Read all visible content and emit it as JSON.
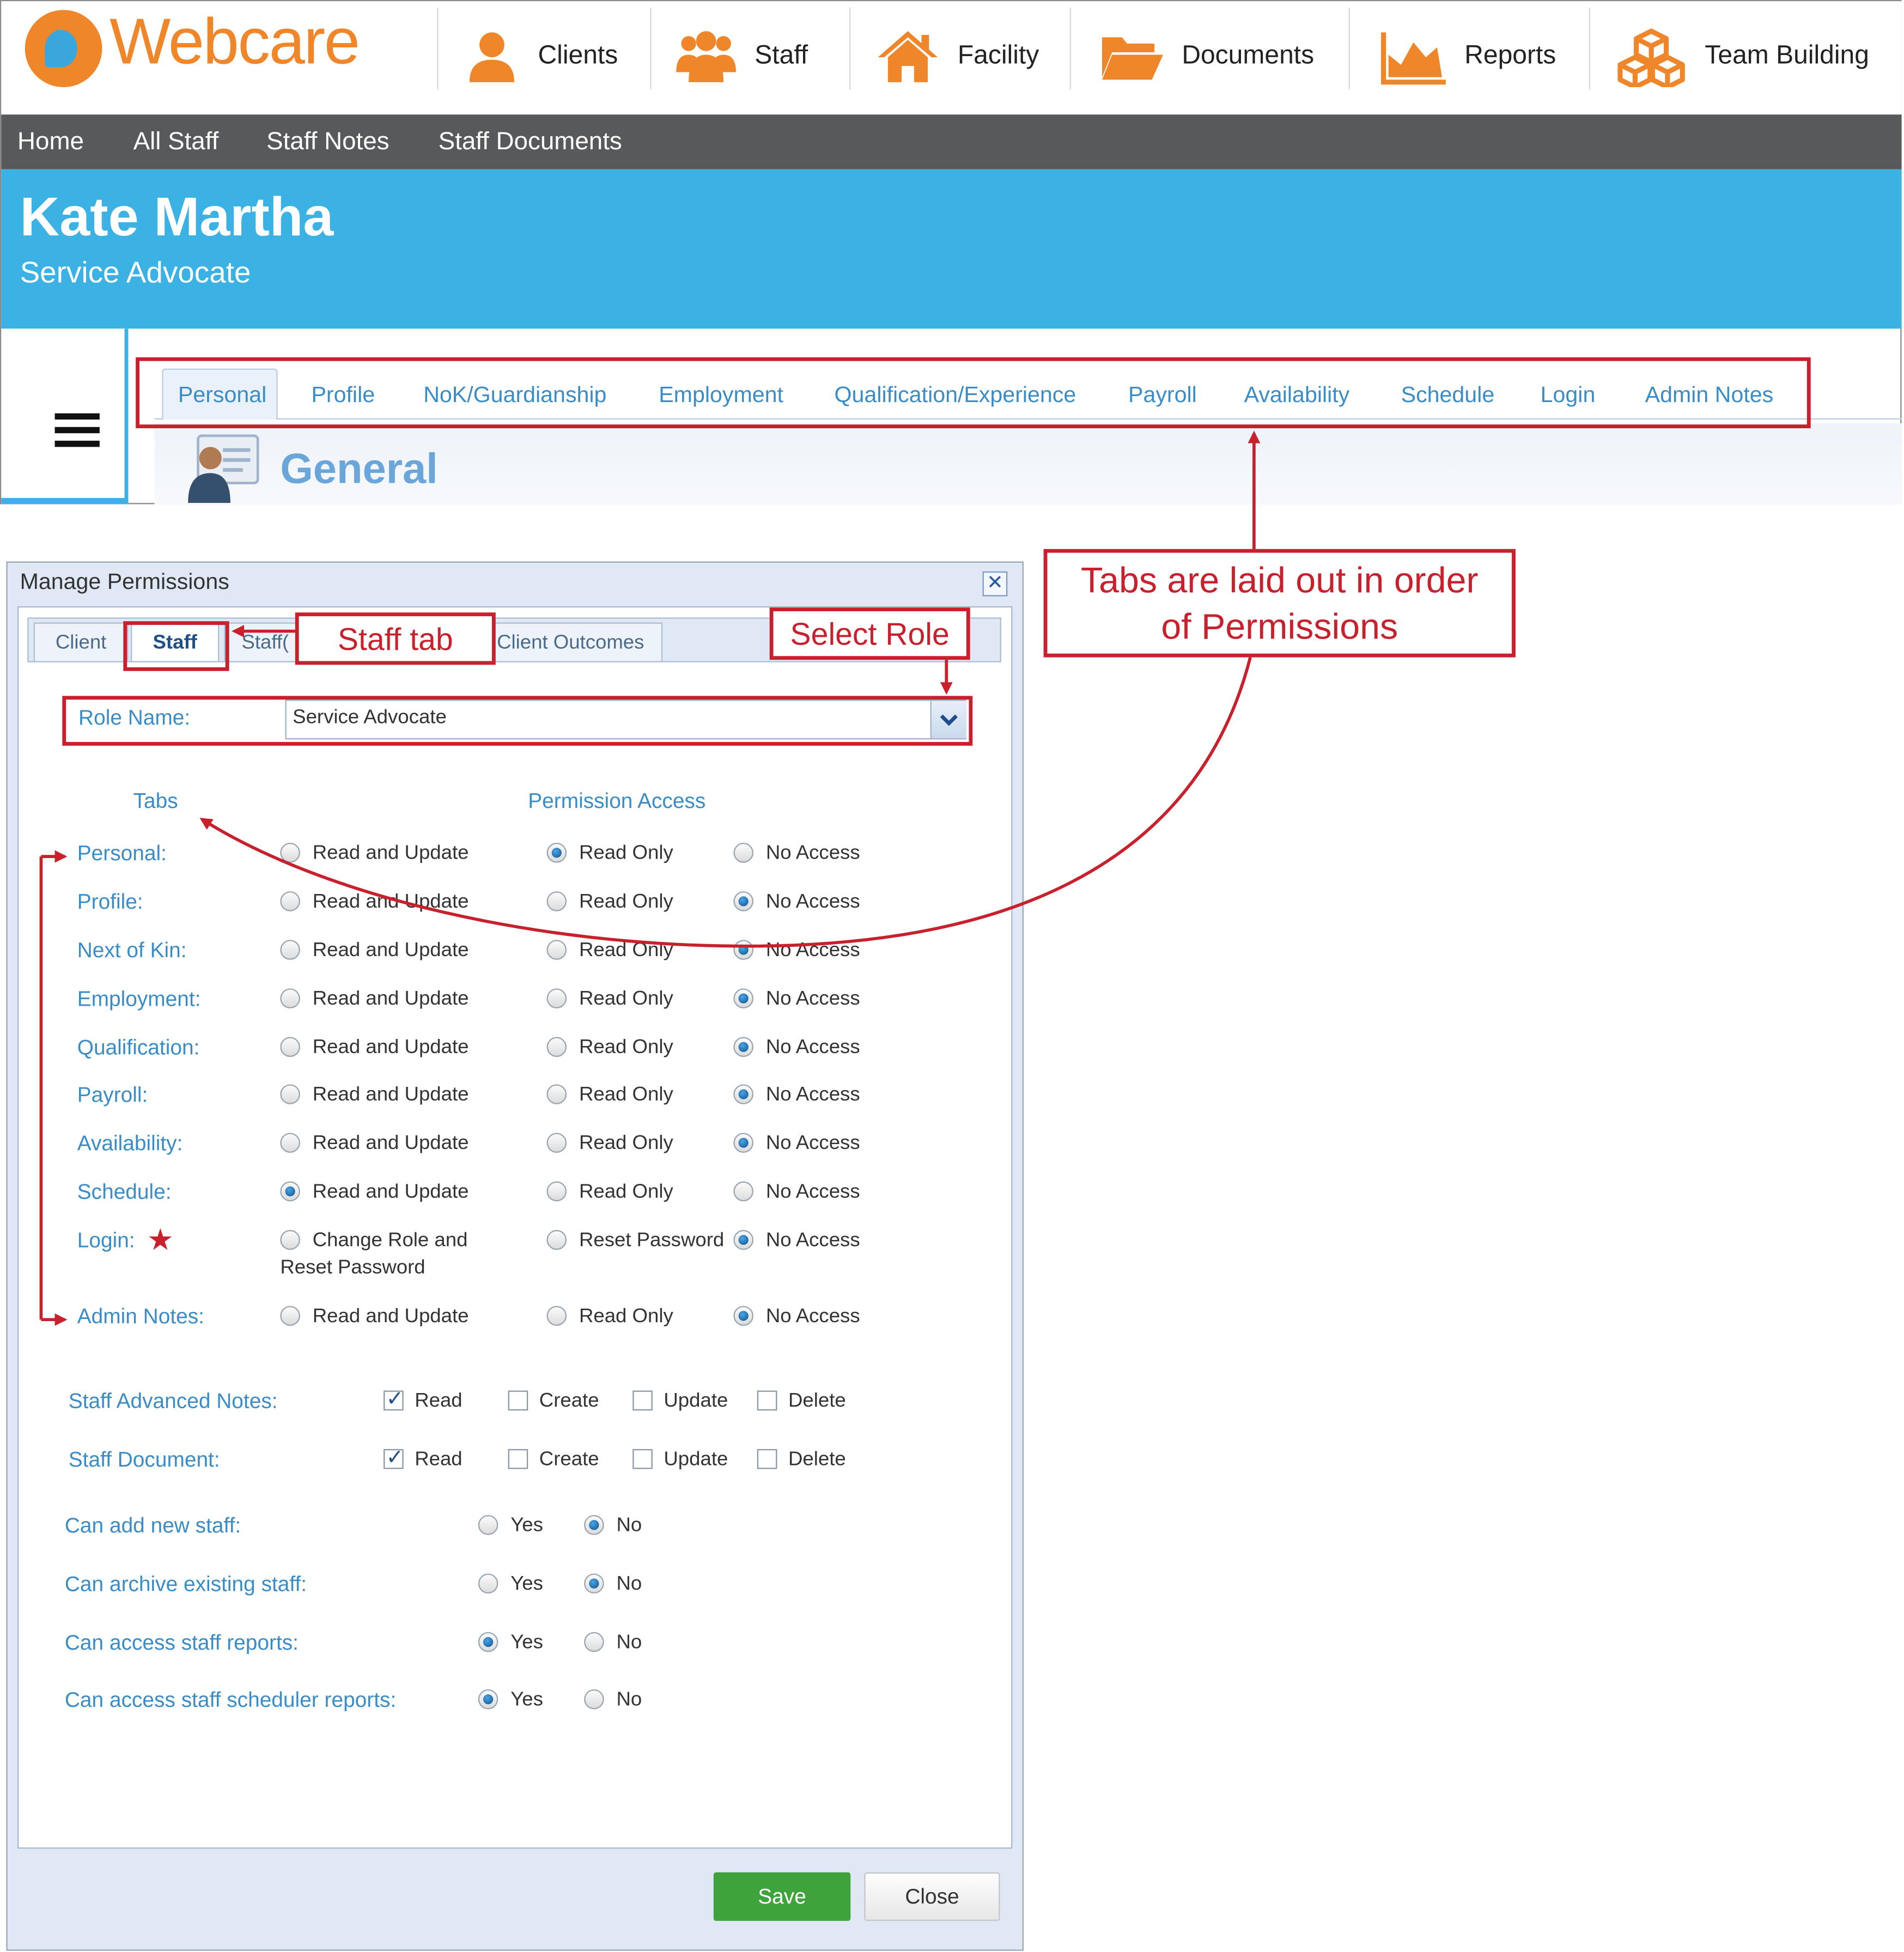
{
  "app": {
    "logo_text": "Webcare"
  },
  "nav": [
    {
      "label": "Clients",
      "icon": "person-icon"
    },
    {
      "label": "Staff",
      "icon": "group-icon"
    },
    {
      "label": "Facility",
      "icon": "house-icon"
    },
    {
      "label": "Documents",
      "icon": "folder-icon"
    },
    {
      "label": "Reports",
      "icon": "area-chart-icon"
    },
    {
      "label": "Team Building",
      "icon": "cubes-icon"
    }
  ],
  "subnav": [
    "Home",
    "All Staff",
    "Staff Notes",
    "Staff Documents"
  ],
  "profile": {
    "name": "Kate Martha",
    "role": "Service Advocate"
  },
  "profile_tabs": {
    "items": [
      "Personal",
      "Profile",
      "NoK/Guardianship",
      "Employment",
      "Qualification/Experience",
      "Payroll",
      "Availability",
      "Schedule",
      "Login",
      "Admin Notes"
    ],
    "active": "Personal"
  },
  "section_title": "General",
  "annotations": {
    "tabs_order_line1": "Tabs are laid out in order",
    "tabs_order_line2": "of Permissions",
    "staff_tab": "Staff tab",
    "select_role": "Select Role"
  },
  "dialog": {
    "title": "Manage Permissions",
    "close_glyph": "✕",
    "tabs": [
      "Client",
      "Staff",
      "Staff(",
      "Client Outcomes"
    ],
    "active_tab": "Staff",
    "role_label": "Role Name:",
    "role_value": "Service Advocate",
    "col_tabs": "Tabs",
    "col_access": "Permission Access",
    "permissions": [
      {
        "label": "Personal:",
        "opt1": "Read and Update",
        "opt2": "Read Only",
        "opt3": "No Access",
        "selected": 2
      },
      {
        "label": "Profile:",
        "opt1": "Read and Update",
        "opt2": "Read Only",
        "opt3": "No Access",
        "selected": 3
      },
      {
        "label": "Next of Kin:",
        "opt1": "Read and Update",
        "opt2": "Read Only",
        "opt3": "No Access",
        "selected": 3
      },
      {
        "label": "Employment:",
        "opt1": "Read and Update",
        "opt2": "Read Only",
        "opt3": "No Access",
        "selected": 3
      },
      {
        "label": "Qualification:",
        "opt1": "Read and Update",
        "opt2": "Read Only",
        "opt3": "No Access",
        "selected": 3
      },
      {
        "label": "Payroll:",
        "opt1": "Read and Update",
        "opt2": "Read Only",
        "opt3": "No Access",
        "selected": 3
      },
      {
        "label": "Availability:",
        "opt1": "Read and Update",
        "opt2": "Read Only",
        "opt3": "No Access",
        "selected": 3
      },
      {
        "label": "Schedule:",
        "opt1": "Read and Update",
        "opt2": "Read Only",
        "opt3": "No Access",
        "selected": 1
      },
      {
        "label": "Login:",
        "opt1": "Change Role and",
        "opt1_line2": "Reset Password",
        "opt2": "Reset Password",
        "opt3": "No Access",
        "selected": 3,
        "marker": "★"
      },
      {
        "label": "Admin Notes:",
        "opt1": "Read and Update",
        "opt2": "Read Only",
        "opt3": "No Access",
        "selected": 3
      }
    ],
    "checks": [
      {
        "label": "Staff Advanced Notes:",
        "read": "Read",
        "create": "Create",
        "update": "Update",
        "delete": "Delete",
        "checked": [
          "read"
        ]
      },
      {
        "label": "Staff Document:",
        "read": "Read",
        "create": "Create",
        "update": "Update",
        "delete": "Delete",
        "checked": [
          "read"
        ]
      }
    ],
    "yesno": [
      {
        "label": "Can add new staff:",
        "yes": "Yes",
        "no": "No",
        "selected": "no"
      },
      {
        "label": "Can archive existing staff:",
        "yes": "Yes",
        "no": "No",
        "selected": "no"
      },
      {
        "label": "Can access staff reports:",
        "yes": "Yes",
        "no": "No",
        "selected": "yes"
      },
      {
        "label": "Can access staff scheduler reports:",
        "yes": "Yes",
        "no": "No",
        "selected": "yes"
      }
    ],
    "save_label": "Save",
    "close_label": "Close"
  },
  "colors": {
    "accent": "#3bb1e4",
    "brand": "#f0862a",
    "annotation": "#c8202c",
    "save": "#3da33a",
    "label_blue": "#3a8cc7"
  }
}
